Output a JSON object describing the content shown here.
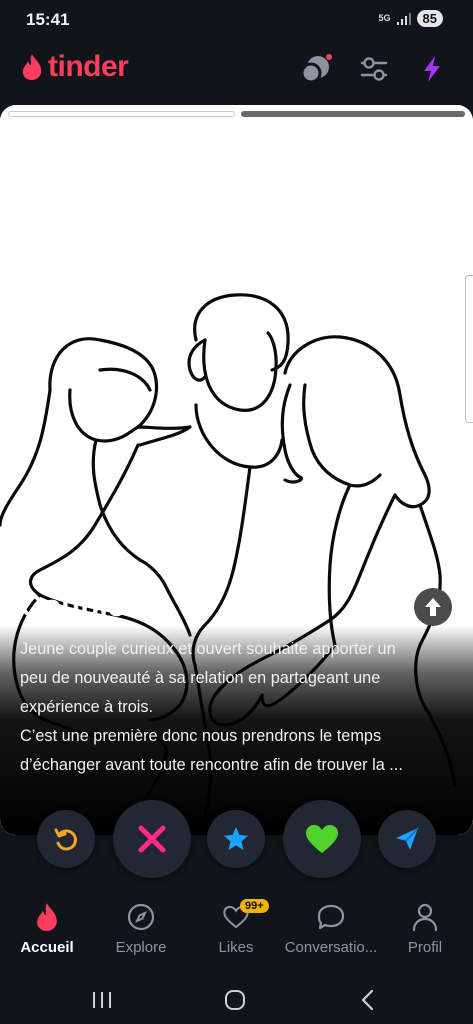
{
  "status_bar": {
    "time": "15:41",
    "network": "5G",
    "battery": "85"
  },
  "header": {
    "brand": "tinder"
  },
  "profile": {
    "name": "Couple",
    "age": "28",
    "bio": [
      "Jeune couple curieux et ouvert souhaite apporter un",
      "peu de nouveauté à sa relation en partageant une",
      "expérience à trois.",
      "C’est une première donc nous prendrons le temps",
      "d’échanger avant toute rencontre afin de trouver la ..."
    ],
    "photos": {
      "count": 2,
      "active_index": 0
    }
  },
  "actions": [
    {
      "icon": "rewind-icon",
      "color": "#f5a623"
    },
    {
      "icon": "nope-icon",
      "color": "#fe2a8a"
    },
    {
      "icon": "super-like-icon",
      "color": "#1aa3ff"
    },
    {
      "icon": "like-icon",
      "color": "#53d12e"
    },
    {
      "icon": "boost-icon",
      "color": "#1aa3ff"
    }
  ],
  "nav": {
    "items": [
      {
        "label": "Accueil",
        "icon": "flame-icon",
        "active": true
      },
      {
        "label": "Explore",
        "icon": "compass-icon",
        "active": false
      },
      {
        "label": "Likes",
        "icon": "heart-icon",
        "active": false,
        "badge": "99+"
      },
      {
        "label": "Conversatio...",
        "icon": "chat-icon",
        "active": false
      },
      {
        "label": "Profil",
        "icon": "person-icon",
        "active": false
      }
    ]
  },
  "colors": {
    "brand": "#fe3d5c",
    "background": "#11141a",
    "boost": "#a335ff"
  }
}
